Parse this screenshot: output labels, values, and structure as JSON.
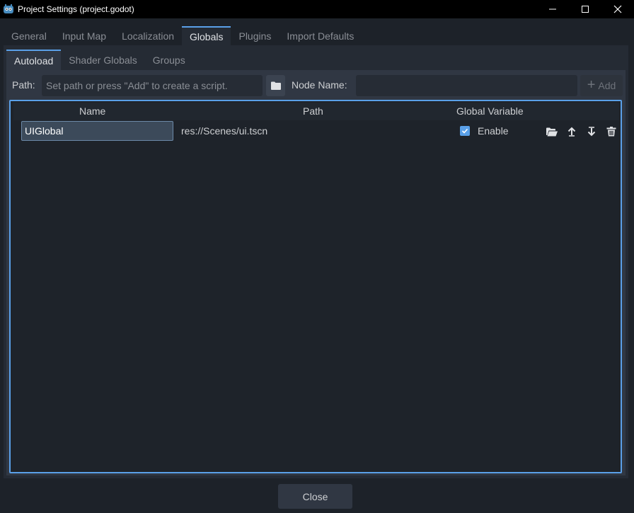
{
  "window": {
    "title": "Project Settings (project.godot)",
    "icons": [
      "godot-logo-icon",
      "minimize-icon",
      "maximize-icon",
      "close-icon"
    ]
  },
  "top_tabs": [
    {
      "label": "General",
      "active": false
    },
    {
      "label": "Input Map",
      "active": false
    },
    {
      "label": "Localization",
      "active": false
    },
    {
      "label": "Globals",
      "active": true
    },
    {
      "label": "Plugins",
      "active": false
    },
    {
      "label": "Import Defaults",
      "active": false
    }
  ],
  "sub_tabs": [
    {
      "label": "Autoload",
      "active": true
    },
    {
      "label": "Shader Globals",
      "active": false
    },
    {
      "label": "Groups",
      "active": false
    }
  ],
  "path_row": {
    "path_label": "Path:",
    "path_placeholder": "Set path or press \"Add\" to create a script.",
    "node_name_label": "Node Name:",
    "node_name_value": "",
    "add_label": "Add"
  },
  "table": {
    "headers": {
      "name": "Name",
      "path": "Path",
      "global": "Global Variable"
    },
    "rows": [
      {
        "name": "UIGlobal",
        "path": "res://Scenes/ui.tscn",
        "enable_label": "Enable",
        "enabled": true
      }
    ]
  },
  "footer": {
    "close_label": "Close"
  },
  "colors": {
    "accent": "#5aa0e8",
    "background": "#1d2229",
    "panel": "#303743"
  }
}
